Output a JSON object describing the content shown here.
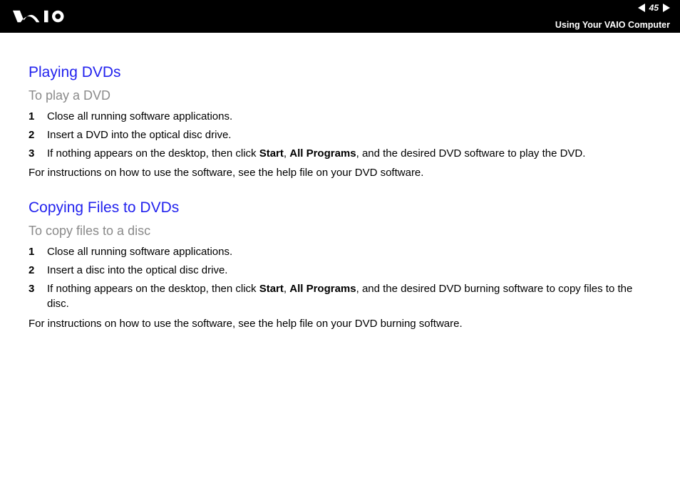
{
  "header": {
    "page_number": "45",
    "breadcrumb": "Using Your VAIO Computer"
  },
  "sections": [
    {
      "heading": "Playing DVDs",
      "subheading": "To play a DVD",
      "steps": [
        {
          "n": "1",
          "text": "Close all running software applications."
        },
        {
          "n": "2",
          "text": "Insert a DVD into the optical disc drive."
        },
        {
          "n": "3",
          "pre": "If nothing appears on the desktop, then click ",
          "b1": "Start",
          "mid1": ", ",
          "b2": "All Programs",
          "post": ", and the desired DVD software to play the DVD."
        }
      ],
      "note": "For instructions on how to use the software, see the help file on your DVD software."
    },
    {
      "heading": "Copying Files to DVDs",
      "subheading": "To copy files to a disc",
      "steps": [
        {
          "n": "1",
          "text": "Close all running software applications."
        },
        {
          "n": "2",
          "text": "Insert a disc into the optical disc drive."
        },
        {
          "n": "3",
          "pre": "If nothing appears on the desktop, then click ",
          "b1": "Start",
          "mid1": ", ",
          "b2": "All Programs",
          "post": ", and the desired DVD burning software to copy files to the disc."
        }
      ],
      "note": "For instructions on how to use the software, see the help file on your DVD burning software."
    }
  ]
}
